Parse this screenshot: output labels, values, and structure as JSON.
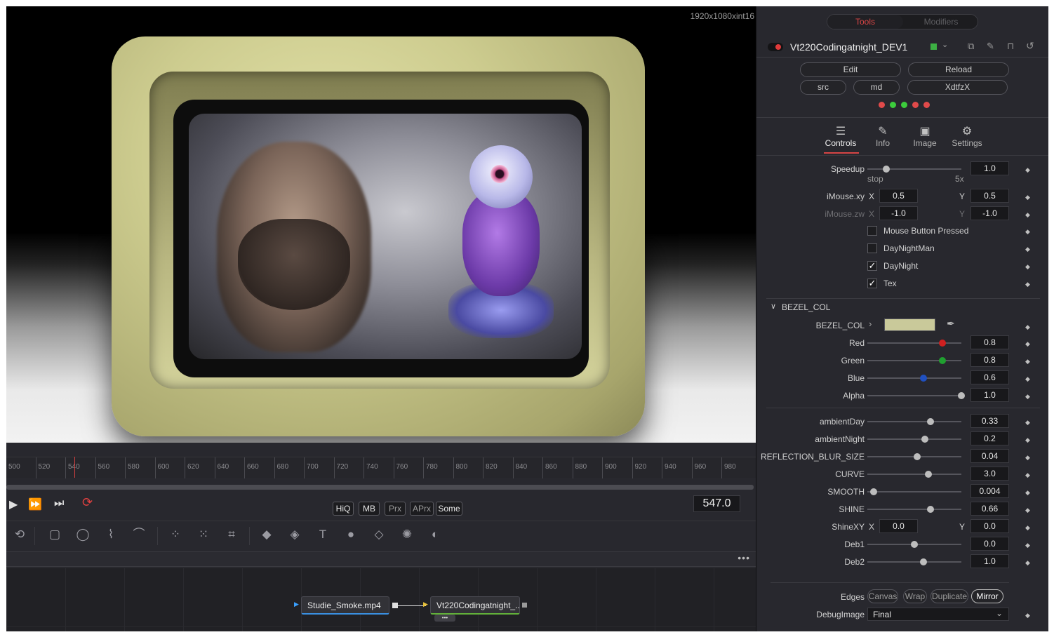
{
  "viewer": {
    "resolution": "1920x1080xint16"
  },
  "timeline": {
    "ticks": [
      "500",
      "520",
      "540",
      "560",
      "580",
      "600",
      "620",
      "640",
      "660",
      "680",
      "700",
      "720",
      "740",
      "760",
      "780",
      "800",
      "820",
      "840",
      "860",
      "880",
      "900",
      "920",
      "940",
      "960",
      "980"
    ]
  },
  "transport": {
    "play": "▶",
    "ffwd": "⏩",
    "end": "⏭",
    "loop": "⟳",
    "hiq": "HiQ",
    "mb": "MB",
    "prx": "Prx",
    "aprx": "APrx",
    "some": "Some",
    "frame": "547.0"
  },
  "nodes": {
    "more": "•••",
    "source": "Studie_Smoke.mp4",
    "target": "Vt220Codingatnight_..."
  },
  "panel": {
    "tab_tools": "Tools",
    "tab_modifiers": "Modifiers",
    "tool_name": "Vt220Codingatnight_DEV1",
    "btn_edit": "Edit",
    "btn_reload": "Reload",
    "btn_src": "src",
    "btn_md": "md",
    "btn_xdtfzx": "XdtfzX",
    "tabs": {
      "controls": "Controls",
      "info": "Info",
      "image": "Image",
      "settings": "Settings"
    },
    "speedup": {
      "label": "Speedup",
      "value": "1.0",
      "min": "stop",
      "max": "5x",
      "pos": 0.2
    },
    "imouse_xy": {
      "label": "iMouse.xy",
      "x_label": "X",
      "x": "0.5",
      "y_label": "Y",
      "y": "0.5"
    },
    "imouse_zw": {
      "label": "iMouse.zw",
      "x_label": "X",
      "x": "-1.0",
      "y_label": "Y",
      "y": "-1.0"
    },
    "checks": [
      {
        "label": "Mouse Button Pressed",
        "checked": false
      },
      {
        "label": "DayNightMan",
        "checked": false
      },
      {
        "label": "DayNight",
        "checked": true
      },
      {
        "label": "Tex",
        "checked": true
      }
    ],
    "bezel_section": "BEZEL_COL",
    "bezel_col": {
      "label": "BEZEL_COL",
      "swatch": "#c9c99a"
    },
    "rgba": [
      {
        "label": "Red",
        "value": "0.8",
        "pos": 0.8,
        "color": "#d02020"
      },
      {
        "label": "Green",
        "value": "0.8",
        "pos": 0.8,
        "color": "#20a030"
      },
      {
        "label": "Blue",
        "value": "0.6",
        "pos": 0.6,
        "color": "#2050c0"
      },
      {
        "label": "Alpha",
        "value": "1.0",
        "pos": 1.0,
        "color": "#bdbdbd"
      }
    ],
    "sliders": [
      {
        "label": "ambientDay",
        "value": "0.33",
        "pos": 0.67
      },
      {
        "label": "ambientNight",
        "value": "0.2",
        "pos": 0.61
      },
      {
        "label": "REFLECTION_BLUR_SIZE",
        "value": "0.04",
        "pos": 0.53
      },
      {
        "label": "CURVE",
        "value": "3.0",
        "pos": 0.65
      },
      {
        "label": "SMOOTH",
        "value": "0.004",
        "pos": 0.07
      },
      {
        "label": "SHINE",
        "value": "0.66",
        "pos": 0.67
      }
    ],
    "shinexy": {
      "label": "ShineXY",
      "x_label": "X",
      "x": "0.0",
      "y_label": "Y",
      "y": "0.0"
    },
    "deb": [
      {
        "label": "Deb1",
        "value": "0.0",
        "pos": 0.5
      },
      {
        "label": "Deb2",
        "value": "1.0",
        "pos": 0.6
      }
    ],
    "edges": {
      "label": "Edges",
      "options": [
        "Canvas",
        "Wrap",
        "Duplicate",
        "Mirror"
      ],
      "selected": "Mirror"
    },
    "debug": {
      "label": "DebugImage",
      "value": "Final"
    }
  }
}
